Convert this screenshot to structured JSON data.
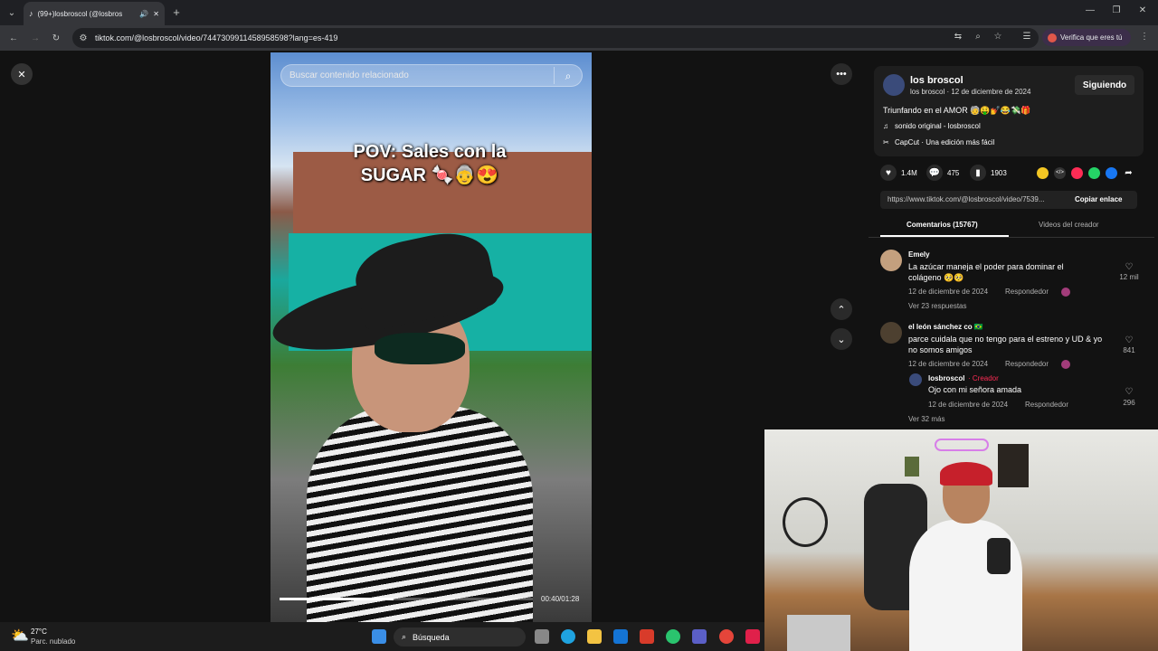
{
  "browser": {
    "tab_title": "(99+)losbroscol (@losbros",
    "url": "tiktok.com/@losbroscol/video/7447309911458958598?lang=es-419",
    "verify_label": "Verifica que eres tú"
  },
  "video": {
    "search_placeholder": "Buscar contenido relacionado",
    "overlay_line1": "POV: Sales con la",
    "overlay_line2": "SUGAR 🍬👵😍",
    "timestamp": "00:40/01:28",
    "progress": 0.45
  },
  "post": {
    "author_name": "los broscol",
    "author_subline": "los broscol · 12 de diciembre de 2024",
    "follow_label": "Siguiendo",
    "caption": "Triunfando en el AMOR 🧓🤑💅😂💸🎁",
    "sound": "sonido original - losbroscol",
    "capcut": "CapCut · Una edición más fácil",
    "likes": "1.4M",
    "comments_count": "475",
    "saves": "1903",
    "link": "https://www.tiktok.com/@losbroscol/video/7539...",
    "copy_label": "Copiar enlace",
    "tab_comments": "Comentarios (15767)",
    "tab_videos": "Videos del creador"
  },
  "comments": [
    {
      "user": "Emely",
      "text": "La azúcar maneja el poder para dominar el colágeno 🥺🥺",
      "date": "12 de diciembre de 2024",
      "reply_label": "Respondedor",
      "likes": "12 mil",
      "more": "Ver 23 respuestas"
    },
    {
      "user": "el león sánchez co 🇧🇷",
      "text": "parce cuidala que no tengo para el estreno y UD & yo no somos amigos",
      "date": "12 de diciembre de 2024",
      "reply_label": "Respondedor",
      "likes": "841",
      "reply": {
        "user": "losbroscol",
        "badge": "· Creador",
        "text": "Ojo con mi señora amada",
        "date": "12 de diciembre de 2024",
        "reply_label": "Respondedor",
        "likes": "296"
      },
      "more": "Ver 32 más"
    }
  ],
  "taskbar": {
    "weather_temp": "27°C",
    "weather_desc": "Parc. nublado",
    "search_label": "Búsqueda"
  }
}
